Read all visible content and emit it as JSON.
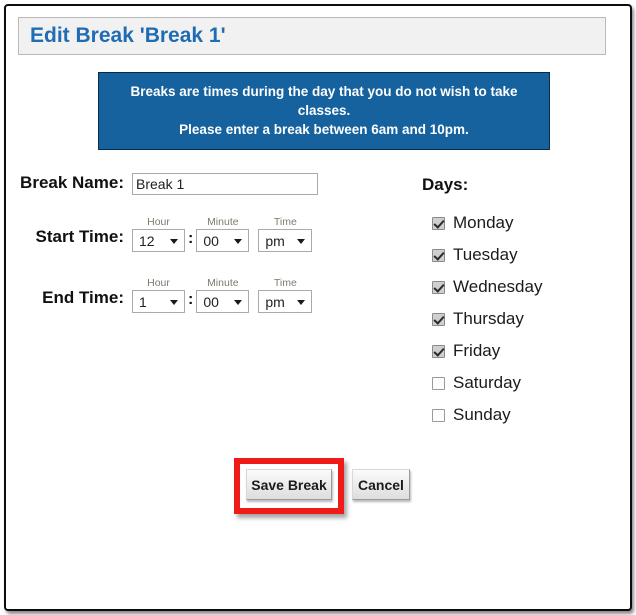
{
  "window": {
    "title": "Edit Break 'Break 1'",
    "accent_color": "#1f6cb4",
    "banner_color": "#15629f",
    "highlight_color": "#ee1b18"
  },
  "banner": {
    "line1": "Breaks are times during the day that you do not wish to take classes.",
    "line2": "Please enter a break between 6am and 10pm."
  },
  "form": {
    "break_name": {
      "label": "Break Name:",
      "value": "Break 1",
      "placeholder": ""
    },
    "start_time": {
      "label": "Start Time:",
      "hour_cap": "Hour",
      "minute_cap": "Minute",
      "ampm_cap": "Time",
      "hour": "12",
      "minute": "00",
      "ampm": "pm",
      "separator": ":"
    },
    "end_time": {
      "label": "End Time:",
      "hour_cap": "Hour",
      "minute_cap": "Minute",
      "ampm_cap": "Time",
      "hour": "1",
      "minute": "00",
      "ampm": "pm",
      "separator": ":"
    }
  },
  "days": {
    "heading": "Days:",
    "items": [
      {
        "label": "Monday",
        "checked": true
      },
      {
        "label": "Tuesday",
        "checked": true
      },
      {
        "label": "Wednesday",
        "checked": true
      },
      {
        "label": "Thursday",
        "checked": true
      },
      {
        "label": "Friday",
        "checked": true
      },
      {
        "label": "Saturday",
        "checked": false
      },
      {
        "label": "Sunday",
        "checked": false
      }
    ]
  },
  "buttons": {
    "save_label": "Save Break",
    "cancel_label": "Cancel"
  }
}
